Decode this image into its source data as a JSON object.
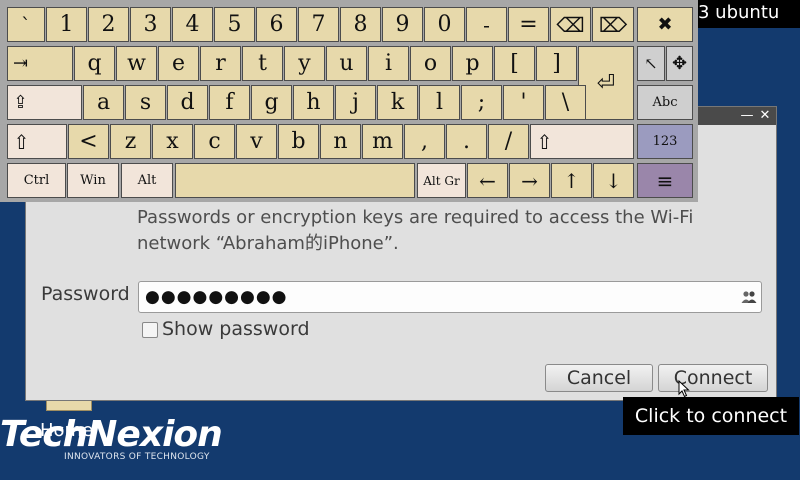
{
  "topbar": {
    "text": "3  ubuntu"
  },
  "desktop": {
    "home_label": "Home",
    "logo_word": "TechNexion",
    "logo_tagline": "INNOVATORS OF TECHNOLOGY"
  },
  "dialog": {
    "message": "Passwords or encryption keys are required to access the Wi-Fi network “Abraham的iPhone”.",
    "password_label": "Password",
    "password_value": "●●●●●●●●●",
    "show_password_label": "Show password",
    "show_password_checked": false,
    "cancel_label": "Cancel",
    "connect_label": "Connect",
    "minimize_glyph": "—",
    "close_glyph": "✕"
  },
  "tooltip": {
    "text": "Click to connect"
  },
  "keyboard": {
    "row1": [
      "`",
      "1",
      "2",
      "3",
      "4",
      "5",
      "6",
      "7",
      "8",
      "9",
      "0",
      "-",
      "="
    ],
    "backspace": "⌫",
    "delete": "⌦",
    "close": "✖",
    "tab": "⇥",
    "row2": [
      "q",
      "w",
      "e",
      "r",
      "t",
      "y",
      "u",
      "i",
      "o",
      "p",
      "[",
      "]"
    ],
    "enter": "⏎",
    "pointer": "↖",
    "move": "✥",
    "capslock": "⇪",
    "row3": [
      "a",
      "s",
      "d",
      "f",
      "g",
      "h",
      "j",
      "k",
      "l",
      ";",
      "'",
      "\\"
    ],
    "abc": "Abc",
    "shift": "⇧",
    "row4": [
      "<",
      "z",
      "x",
      "c",
      "v",
      "b",
      "n",
      "m",
      ",",
      ".",
      "/"
    ],
    "num": "123",
    "ctrl": "Ctrl",
    "win": "Win",
    "alt": "Alt",
    "space": "",
    "altgr": "Alt Gr",
    "arrows": [
      "←",
      "→",
      "↑",
      "↓"
    ],
    "menu": "≡"
  }
}
